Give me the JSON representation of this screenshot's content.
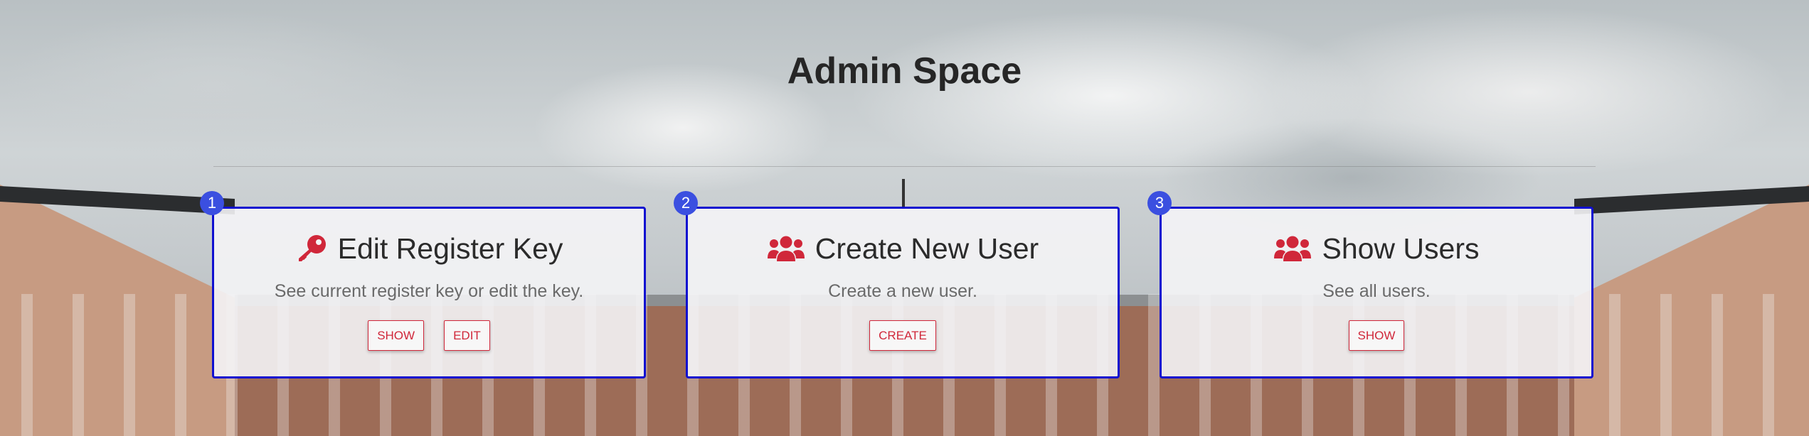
{
  "page": {
    "title": "Admin Space"
  },
  "colors": {
    "accent": "#d0273a",
    "card_border": "#1010d0",
    "badge": "#3b4fe0"
  },
  "cards": [
    {
      "badge": "1",
      "icon": "key-icon",
      "title": "Edit Register Key",
      "description": "See current register key or edit the key.",
      "buttons": [
        "SHOW",
        "EDIT"
      ]
    },
    {
      "badge": "2",
      "icon": "users-icon",
      "title": "Create New User",
      "description": "Create a new user.",
      "buttons": [
        "CREATE"
      ]
    },
    {
      "badge": "3",
      "icon": "users-icon",
      "title": "Show Users",
      "description": "See all users.",
      "buttons": [
        "SHOW"
      ]
    }
  ]
}
